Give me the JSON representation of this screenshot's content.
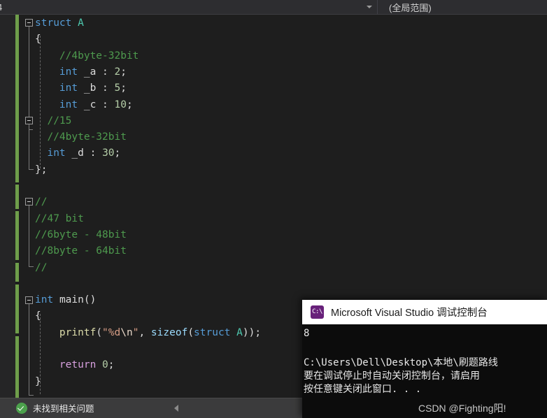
{
  "nav": {
    "left_value": "4",
    "left_chevron_icon": "chevron-down-icon",
    "right_value": "(全局范围)"
  },
  "editor": {
    "lines": [
      {
        "indent": 0,
        "tokens": [
          {
            "t": "struct ",
            "c": "kw"
          },
          {
            "t": "A",
            "c": "type"
          }
        ]
      },
      {
        "indent": 0,
        "tokens": [
          {
            "t": "{",
            "c": "punc"
          }
        ]
      },
      {
        "indent": 0,
        "tokens": [
          {
            "t": "    //4byte-32bit",
            "c": "cmt"
          }
        ]
      },
      {
        "indent": 0,
        "tokens": [
          {
            "t": "    ",
            "c": "punc"
          },
          {
            "t": "int",
            "c": "kw"
          },
          {
            "t": " _a : ",
            "c": "id"
          },
          {
            "t": "2",
            "c": "num"
          },
          {
            "t": ";",
            "c": "punc"
          }
        ]
      },
      {
        "indent": 0,
        "tokens": [
          {
            "t": "    ",
            "c": "punc"
          },
          {
            "t": "int",
            "c": "kw"
          },
          {
            "t": " _b : ",
            "c": "id"
          },
          {
            "t": "5",
            "c": "num"
          },
          {
            "t": ";",
            "c": "punc"
          }
        ]
      },
      {
        "indent": 0,
        "tokens": [
          {
            "t": "    ",
            "c": "punc"
          },
          {
            "t": "int",
            "c": "kw"
          },
          {
            "t": " _c : ",
            "c": "id"
          },
          {
            "t": "10",
            "c": "num"
          },
          {
            "t": ";",
            "c": "punc"
          }
        ]
      },
      {
        "indent": 0,
        "tokens": [
          {
            "t": "  //15",
            "c": "cmt"
          }
        ]
      },
      {
        "indent": 0,
        "tokens": [
          {
            "t": "  //4byte-32bit",
            "c": "cmt"
          }
        ]
      },
      {
        "indent": 0,
        "tokens": [
          {
            "t": "  ",
            "c": "punc"
          },
          {
            "t": "int",
            "c": "kw"
          },
          {
            "t": " _d : ",
            "c": "id"
          },
          {
            "t": "30",
            "c": "num"
          },
          {
            "t": ";",
            "c": "punc"
          }
        ]
      },
      {
        "indent": 0,
        "tokens": [
          {
            "t": "};",
            "c": "punc"
          }
        ]
      },
      {
        "indent": 0,
        "tokens": [
          {
            "t": "",
            "c": "punc"
          }
        ]
      },
      {
        "indent": 0,
        "tokens": [
          {
            "t": "//",
            "c": "cmt"
          }
        ]
      },
      {
        "indent": 0,
        "tokens": [
          {
            "t": "//47 bit",
            "c": "cmt"
          }
        ]
      },
      {
        "indent": 0,
        "tokens": [
          {
            "t": "//6byte - 48bit",
            "c": "cmt"
          }
        ]
      },
      {
        "indent": 0,
        "tokens": [
          {
            "t": "//8byte - 64bit",
            "c": "cmt"
          }
        ]
      },
      {
        "indent": 0,
        "tokens": [
          {
            "t": "//",
            "c": "cmt"
          }
        ]
      },
      {
        "indent": 0,
        "tokens": [
          {
            "t": "",
            "c": "punc"
          }
        ]
      },
      {
        "indent": 0,
        "tokens": [
          {
            "t": "int",
            "c": "kw"
          },
          {
            "t": " ",
            "c": "id"
          },
          {
            "t": "main",
            "c": "id"
          },
          {
            "t": "()",
            "c": "punc"
          }
        ]
      },
      {
        "indent": 0,
        "tokens": [
          {
            "t": "{",
            "c": "punc"
          }
        ]
      },
      {
        "indent": 0,
        "tokens": [
          {
            "t": "    ",
            "c": "punc"
          },
          {
            "t": "printf",
            "c": "fn"
          },
          {
            "t": "(",
            "c": "punc"
          },
          {
            "t": "\"%d",
            "c": "str"
          },
          {
            "t": "\\n",
            "c": "esc"
          },
          {
            "t": "\"",
            "c": "str"
          },
          {
            "t": ", ",
            "c": "punc"
          },
          {
            "t": "sizeof",
            "c": "sizeof"
          },
          {
            "t": "(",
            "c": "punc"
          },
          {
            "t": "struct",
            "c": "kw"
          },
          {
            "t": " ",
            "c": "id"
          },
          {
            "t": "A",
            "c": "type"
          },
          {
            "t": "));",
            "c": "punc"
          }
        ]
      },
      {
        "indent": 0,
        "tokens": [
          {
            "t": "",
            "c": "punc"
          }
        ]
      },
      {
        "indent": 0,
        "tokens": [
          {
            "t": "    ",
            "c": "punc"
          },
          {
            "t": "return",
            "c": "kw2"
          },
          {
            "t": " ",
            "c": "id"
          },
          {
            "t": "0",
            "c": "num"
          },
          {
            "t": ";",
            "c": "punc"
          }
        ]
      },
      {
        "indent": 0,
        "tokens": [
          {
            "t": "}",
            "c": "punc"
          }
        ]
      }
    ]
  },
  "status": {
    "icon": "check-circle-icon",
    "message": "未找到相关问题",
    "collapse_icon": "triangle-left-icon"
  },
  "console": {
    "icon": "console-app-icon",
    "icon_glyph": "C:\\",
    "title": "Microsoft Visual Studio 调试控制台",
    "lines": [
      "8",
      "",
      "C:\\Users\\Dell\\Desktop\\本地\\刷题路线",
      "要在调试停止时自动关闭控制台，请启用",
      "按任意键关闭此窗口. . ."
    ],
    "watermark": "CSDN @Fighting阳!"
  }
}
